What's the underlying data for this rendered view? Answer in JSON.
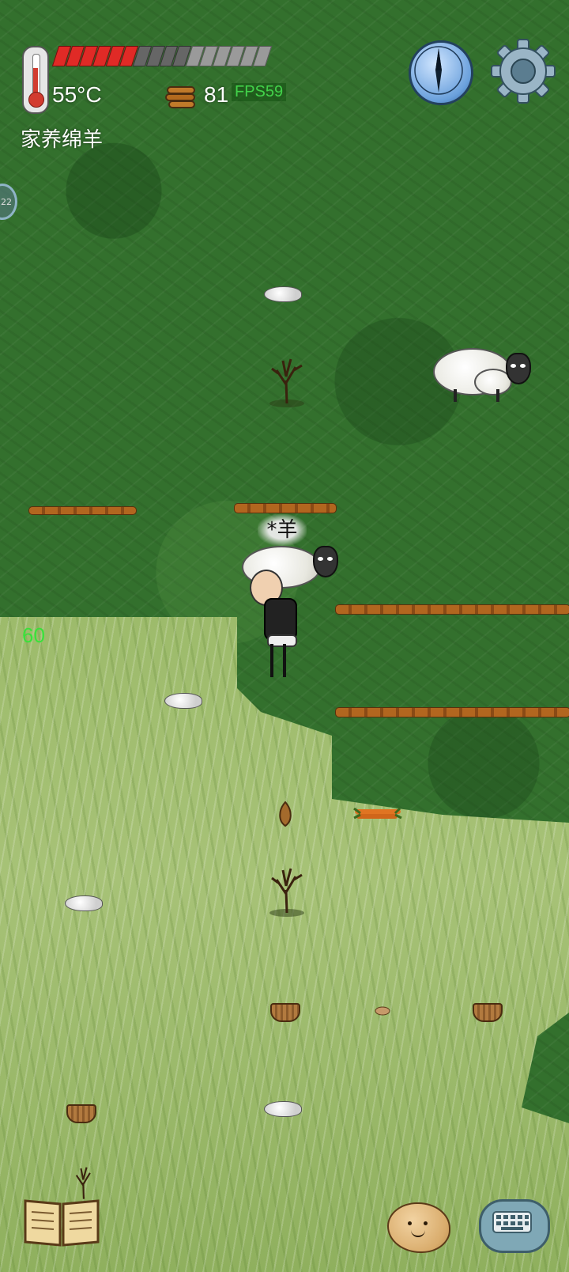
{
  "hud": {
    "temperature": "55°C",
    "health": {
      "segments": 16,
      "filled": 6
    },
    "wood_count": "81",
    "fps_label": "FPS59",
    "mode_label": "家养绵羊",
    "left_counter": "60",
    "side_badge": "22"
  },
  "world": {
    "speech_bubble": "*羊"
  },
  "icons": {
    "thermometer": "thermometer-icon",
    "wood": "wood-logs-icon",
    "compass": "compass-icon",
    "settings": "gear-icon",
    "journal": "open-book-icon",
    "emote": "potato-face-icon",
    "chat": "keyboard-chat-icon"
  },
  "colors": {
    "health_red": "#e02a26",
    "fps_green": "#42d24a",
    "counter_green": "#38e23a"
  }
}
